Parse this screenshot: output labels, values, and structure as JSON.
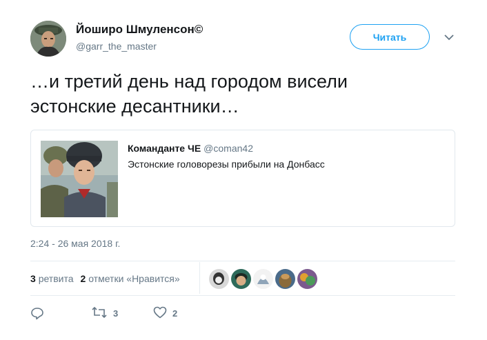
{
  "author": {
    "name": "Йоширо Шмуленсон©",
    "handle": "@garr_the_master"
  },
  "follow_button": {
    "label": "Читать"
  },
  "tweet": {
    "line1": "…и третий день над городом висели",
    "line2": "эстонские десантники…"
  },
  "quoted_tweet": {
    "author_name": "Команданте ЧЕ",
    "author_handle": "@coman42",
    "text": "Эстонские головорезы прибыли на Донбасс"
  },
  "timestamp": "2:24 - 26 мая 2018 г.",
  "stats": {
    "retweets_count": "3",
    "retweets_label": "ретвита",
    "likes_count": "2",
    "likes_label": "отметки «Нравится»"
  },
  "actions": {
    "retweet_count": "3",
    "like_count": "2"
  },
  "icons": {
    "caret": "chevron-down-icon",
    "reply": "reply-icon",
    "retweet": "retweet-icon",
    "like": "heart-icon"
  },
  "colors": {
    "accent": "#1da1f2",
    "secondary_text": "#657786",
    "border": "#e1e8ed"
  }
}
